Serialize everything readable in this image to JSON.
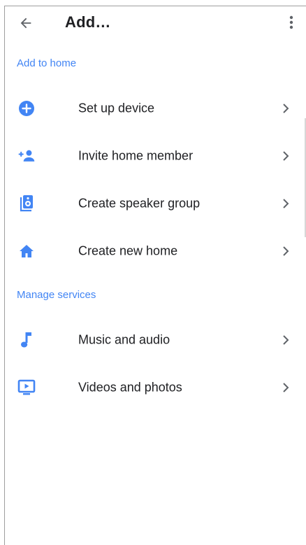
{
  "header": {
    "title": "Add…"
  },
  "sections": [
    {
      "title": "Add to home",
      "items": [
        {
          "label": "Set up device",
          "icon": "add-circle-icon"
        },
        {
          "label": "Invite home member",
          "icon": "person-add-icon"
        },
        {
          "label": "Create speaker group",
          "icon": "speaker-icon"
        },
        {
          "label": "Create new home",
          "icon": "home-icon"
        }
      ]
    },
    {
      "title": "Manage services",
      "items": [
        {
          "label": "Music and audio",
          "icon": "music-note-icon"
        },
        {
          "label": "Videos and photos",
          "icon": "video-display-icon"
        }
      ]
    }
  ],
  "colors": {
    "accent": "#4285f4",
    "text": "#202124",
    "icon_gray": "#5f6368"
  }
}
